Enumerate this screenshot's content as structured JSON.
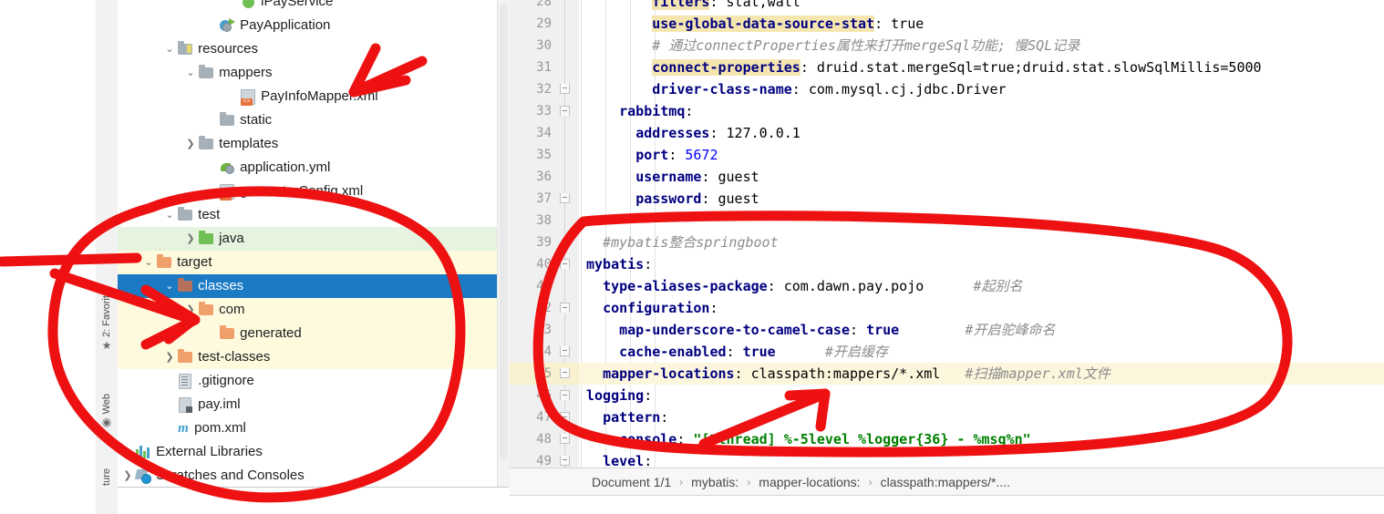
{
  "tool_rail": {
    "items": [
      {
        "label": "2: Favorite",
        "icon": "star-icon",
        "glyph": "★"
      },
      {
        "label": "Web",
        "icon": "globe-icon",
        "glyph": "◉"
      },
      {
        "label": "ture",
        "icon": "structure-icon",
        "glyph": ""
      }
    ]
  },
  "project_tree": {
    "rows": [
      {
        "label": "iPayService",
        "icon": "interface-icon",
        "indent": 6,
        "arrow": "",
        "state": "normal",
        "clipped": true
      },
      {
        "label": "PayApplication",
        "icon": "spring-boot-class-icon",
        "indent": 5,
        "arrow": "",
        "state": "normal"
      },
      {
        "label": "resources",
        "icon": "resources-folder-icon",
        "indent": 3,
        "arrow": "expanded",
        "state": "normal"
      },
      {
        "label": "mappers",
        "icon": "folder-grey-icon",
        "indent": 4,
        "arrow": "expanded",
        "state": "normal"
      },
      {
        "label": "PayInfoMapper.xml",
        "icon": "xml-file-icon",
        "indent": 6,
        "arrow": "",
        "state": "normal"
      },
      {
        "label": "static",
        "icon": "folder-grey-icon",
        "indent": 5,
        "arrow": "",
        "state": "normal"
      },
      {
        "label": "templates",
        "icon": "folder-grey-icon",
        "indent": 4,
        "arrow": "collapsed",
        "state": "normal"
      },
      {
        "label": "application.yml",
        "icon": "spring-yaml-icon",
        "indent": 5,
        "arrow": "",
        "state": "normal"
      },
      {
        "label": "generatorConfig.xml",
        "icon": "xml-file-icon",
        "indent": 5,
        "arrow": "",
        "state": "normal"
      },
      {
        "label": "test",
        "icon": "folder-grey-icon",
        "indent": 3,
        "arrow": "expanded",
        "state": "normal"
      },
      {
        "label": "java",
        "icon": "folder-green-icon",
        "indent": 4,
        "arrow": "collapsed",
        "state": "test-source"
      },
      {
        "label": "target",
        "icon": "folder-orange-icon",
        "indent": 2,
        "arrow": "expanded",
        "state": "excluded"
      },
      {
        "label": "classes",
        "icon": "folder-brown-icon",
        "indent": 3,
        "arrow": "expanded",
        "state": "selected"
      },
      {
        "label": "com",
        "icon": "folder-orange-icon",
        "indent": 4,
        "arrow": "collapsed",
        "state": "excluded"
      },
      {
        "label": "generated",
        "icon": "folder-orange-icon",
        "indent": 5,
        "arrow": "",
        "state": "excluded"
      },
      {
        "label": "test-classes",
        "icon": "folder-orange-icon",
        "indent": 3,
        "arrow": "collapsed",
        "state": "excluded"
      },
      {
        "label": ".gitignore",
        "icon": "text-file-icon",
        "indent": 3,
        "arrow": "",
        "state": "normal"
      },
      {
        "label": "pay.iml",
        "icon": "iml-file-icon",
        "indent": 3,
        "arrow": "",
        "state": "normal"
      },
      {
        "label": "pom.xml",
        "icon": "maven-pom-icon",
        "indent": 3,
        "arrow": "",
        "state": "normal"
      },
      {
        "label": "External Libraries",
        "icon": "libraries-icon",
        "indent": 1,
        "arrow": "collapsed",
        "state": "normal"
      },
      {
        "label": "Scratches and Consoles",
        "icon": "scratches-icon",
        "indent": 1,
        "arrow": "collapsed",
        "state": "normal"
      }
    ]
  },
  "editor": {
    "first_line_number": 28,
    "caret_line": 45,
    "lines": [
      {
        "n": 28,
        "fold": "",
        "segments": [
          {
            "t": "        ",
            "c": "pl"
          },
          {
            "t": "filters",
            "c": "kw hl"
          },
          {
            "t": ": stat,wall",
            "c": "pl"
          }
        ]
      },
      {
        "n": 29,
        "fold": "",
        "segments": [
          {
            "t": "        ",
            "c": "pl"
          },
          {
            "t": "use-global-data-source-stat",
            "c": "kw hl"
          },
          {
            "t": ": true",
            "c": "pl"
          }
        ]
      },
      {
        "n": 30,
        "fold": "",
        "segments": [
          {
            "t": "        # 通过connectProperties属性来打开mergeSql功能; 慢SQL记录",
            "c": "cmt"
          }
        ]
      },
      {
        "n": 31,
        "fold": "",
        "segments": [
          {
            "t": "        ",
            "c": "pl"
          },
          {
            "t": "connect-properties",
            "c": "kw hl"
          },
          {
            "t": ": druid.stat.mergeSql=true;druid.stat.slowSqlMillis=5000",
            "c": "pl"
          }
        ]
      },
      {
        "n": 32,
        "fold": "up",
        "segments": [
          {
            "t": "        ",
            "c": "pl"
          },
          {
            "t": "driver-class-name",
            "c": "kw"
          },
          {
            "t": ": com.mysql.cj.jdbc.Driver",
            "c": "pl"
          }
        ]
      },
      {
        "n": 33,
        "fold": "down",
        "segments": [
          {
            "t": "    ",
            "c": "pl"
          },
          {
            "t": "rabbitmq",
            "c": "kw"
          },
          {
            "t": ":",
            "c": "pl"
          }
        ]
      },
      {
        "n": 34,
        "fold": "",
        "segments": [
          {
            "t": "      ",
            "c": "pl"
          },
          {
            "t": "addresses",
            "c": "kw"
          },
          {
            "t": ": 127.0.0.1",
            "c": "pl"
          }
        ]
      },
      {
        "n": 35,
        "fold": "",
        "segments": [
          {
            "t": "      ",
            "c": "pl"
          },
          {
            "t": "port",
            "c": "kw"
          },
          {
            "t": ": ",
            "c": "pl"
          },
          {
            "t": "5672",
            "c": "num"
          }
        ]
      },
      {
        "n": 36,
        "fold": "",
        "segments": [
          {
            "t": "      ",
            "c": "pl"
          },
          {
            "t": "username",
            "c": "kw"
          },
          {
            "t": ": guest",
            "c": "pl"
          }
        ]
      },
      {
        "n": 37,
        "fold": "up",
        "segments": [
          {
            "t": "      ",
            "c": "pl"
          },
          {
            "t": "password",
            "c": "kw"
          },
          {
            "t": ": guest",
            "c": "pl"
          }
        ]
      },
      {
        "n": 38,
        "fold": "",
        "segments": [
          {
            "t": "",
            "c": "pl"
          }
        ]
      },
      {
        "n": 39,
        "fold": "",
        "segments": [
          {
            "t": "  #mybatis整合springboot",
            "c": "cmt"
          }
        ]
      },
      {
        "n": 40,
        "fold": "down",
        "segments": [
          {
            "t": "",
            "c": "pl"
          },
          {
            "t": "mybatis",
            "c": "kw"
          },
          {
            "t": ":",
            "c": "pl"
          }
        ]
      },
      {
        "n": 41,
        "fold": "",
        "segments": [
          {
            "t": "  ",
            "c": "pl"
          },
          {
            "t": "type-aliases-package",
            "c": "kw"
          },
          {
            "t": ": com.dawn.pay.pojo",
            "c": "pl"
          },
          {
            "t": "      #起别名",
            "c": "cmt"
          }
        ]
      },
      {
        "n": 42,
        "fold": "down",
        "segments": [
          {
            "t": "  ",
            "c": "pl"
          },
          {
            "t": "configuration",
            "c": "kw"
          },
          {
            "t": ":",
            "c": "pl"
          }
        ]
      },
      {
        "n": 43,
        "fold": "",
        "segments": [
          {
            "t": "    ",
            "c": "pl"
          },
          {
            "t": "map-underscore-to-camel-case",
            "c": "kw"
          },
          {
            "t": ": ",
            "c": "pl"
          },
          {
            "t": "true",
            "c": "kw"
          },
          {
            "t": "        #开启驼峰命名",
            "c": "cmt"
          }
        ]
      },
      {
        "n": 44,
        "fold": "up",
        "segments": [
          {
            "t": "    ",
            "c": "pl"
          },
          {
            "t": "cache-enabled",
            "c": "kw"
          },
          {
            "t": ": ",
            "c": "pl"
          },
          {
            "t": "true",
            "c": "kw"
          },
          {
            "t": "      #开启缓存",
            "c": "cmt"
          }
        ]
      },
      {
        "n": 45,
        "fold": "up",
        "segments": [
          {
            "t": "  ",
            "c": "pl"
          },
          {
            "t": "mapper-locations",
            "c": "kw"
          },
          {
            "t": ": classpath:mappers/*.xml",
            "c": "pl"
          },
          {
            "t": "   #扫描mapper.xml文件",
            "c": "cmt"
          }
        ]
      },
      {
        "n": 46,
        "fold": "down",
        "segments": [
          {
            "t": "",
            "c": "pl"
          },
          {
            "t": "logging",
            "c": "kw"
          },
          {
            "t": ":",
            "c": "pl"
          }
        ]
      },
      {
        "n": 47,
        "fold": "down",
        "segments": [
          {
            "t": "  ",
            "c": "pl"
          },
          {
            "t": "pattern",
            "c": "kw"
          },
          {
            "t": ":",
            "c": "pl"
          }
        ]
      },
      {
        "n": 48,
        "fold": "up",
        "segments": [
          {
            "t": "    ",
            "c": "pl"
          },
          {
            "t": "console",
            "c": "kw"
          },
          {
            "t": ": ",
            "c": "pl"
          },
          {
            "t": "\"[%thread] %-5level %logger{36} - %msg%n\"",
            "c": "str"
          }
        ]
      },
      {
        "n": 49,
        "fold": "up",
        "segments": [
          {
            "t": "  ",
            "c": "pl"
          },
          {
            "t": "level",
            "c": "kw"
          },
          {
            "t": ":",
            "c": "pl"
          }
        ]
      }
    ]
  },
  "breadcrumb": {
    "items": [
      "Document 1/1",
      "mybatis:",
      "mapper-locations:",
      "classpath:mappers/*...."
    ],
    "separator": "›"
  },
  "annotations": {
    "ink_color": "#ee1111",
    "marks": [
      {
        "name": "arrow-to-payinfomapper",
        "type": "arrow"
      },
      {
        "name": "oval-around-target-tree",
        "type": "oval"
      },
      {
        "name": "arrow-into-target-tree",
        "type": "arrow"
      },
      {
        "name": "oval-around-mybatis-logging-config",
        "type": "oval"
      },
      {
        "name": "arrow-to-console-pattern",
        "type": "arrow"
      }
    ]
  }
}
